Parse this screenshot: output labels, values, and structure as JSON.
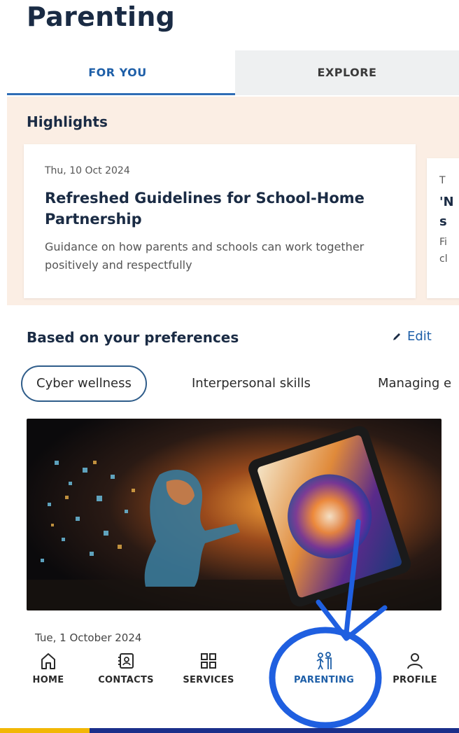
{
  "page": {
    "title": "Parenting"
  },
  "tabs": {
    "for_you": "FOR YOU",
    "explore": "EXPLORE"
  },
  "highlights": {
    "title": "Highlights",
    "cards": [
      {
        "date": "Thu, 10 Oct 2024",
        "title": "Refreshed Guidelines for School-Home Partnership",
        "description": "Guidance on how parents and schools can work together positively and respectfully"
      },
      {
        "date": "T",
        "title_line1": "'N",
        "title_line2": "s",
        "desc_line1": "Fi",
        "desc_line2": "cl"
      }
    ]
  },
  "preferences": {
    "title": "Based on your preferences",
    "edit": "Edit",
    "chips": [
      "Cyber wellness",
      "Interpersonal skills",
      "Managing e"
    ]
  },
  "article": {
    "date": "Tue, 1 October 2024"
  },
  "nav": {
    "home": "HOME",
    "contacts": "CONTACTS",
    "services": "SERVICES",
    "parenting": "PARENTING",
    "profile": "PROFILE"
  },
  "colors": {
    "accent": "#1e5fa8",
    "highlight_bg": "#fbeee4",
    "annotation": "#1f5fe0"
  }
}
